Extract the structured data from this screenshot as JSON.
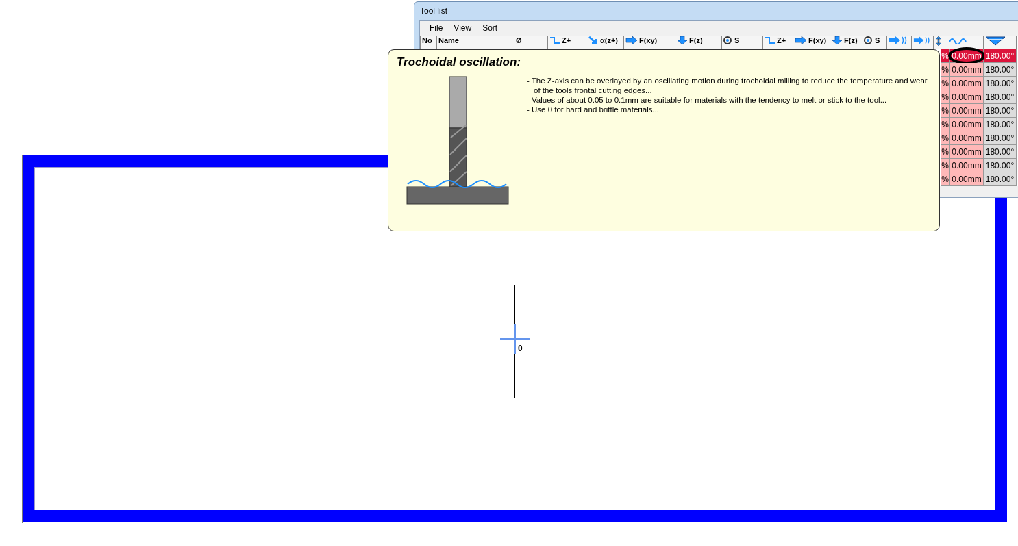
{
  "canvas": {
    "origin_label": "0"
  },
  "tool_list": {
    "title": "Tool list",
    "menu": [
      "File",
      "View",
      "Sort"
    ],
    "columns": [
      {
        "kind": "plain",
        "label": "No"
      },
      {
        "kind": "plain",
        "label": "Name"
      },
      {
        "kind": "plain",
        "label": "Ø"
      },
      {
        "kind": "step",
        "label": "Z+"
      },
      {
        "kind": "angle",
        "label": "α(z+)"
      },
      {
        "kind": "arrow",
        "label": "F(xy)"
      },
      {
        "kind": "down",
        "label": "F(z)"
      },
      {
        "kind": "spindle",
        "label": "S"
      },
      {
        "kind": "step",
        "label": "Z+"
      },
      {
        "kind": "arrow",
        "label": "F(xy)"
      },
      {
        "kind": "down",
        "label": "F(z)"
      },
      {
        "kind": "spindle",
        "label": "S"
      },
      {
        "kind": "arrowwave"
      },
      {
        "kind": "arrowwave"
      },
      {
        "kind": "updown"
      },
      {
        "kind": "wave"
      },
      {
        "kind": "cone"
      }
    ],
    "rows": [
      {
        "selected": true,
        "cells": [
          "%",
          "0.00mm",
          "180.00°"
        ]
      },
      {
        "selected": false,
        "cells": [
          "%",
          "0.00mm",
          "180.00°"
        ]
      },
      {
        "selected": false,
        "cells": [
          "%",
          "0.00mm",
          "180.00°"
        ]
      },
      {
        "selected": false,
        "cells": [
          "%",
          "0.00mm",
          "180.00°"
        ]
      },
      {
        "selected": false,
        "cells": [
          "%",
          "0.00mm",
          "180.00°"
        ]
      },
      {
        "selected": false,
        "cells": [
          "%",
          "0.00mm",
          "180.00°"
        ]
      },
      {
        "selected": false,
        "cells": [
          "%",
          "0.00mm",
          "180.00°"
        ]
      },
      {
        "selected": false,
        "cells": [
          "%",
          "0.00mm",
          "180.00°"
        ]
      },
      {
        "selected": false,
        "cells": [
          "%",
          "0.00mm",
          "180.00°"
        ]
      },
      {
        "selected": false,
        "cells": [
          "%",
          "0.00mm",
          "180.00°"
        ]
      }
    ]
  },
  "tooltip": {
    "title": "Trochoidal  oscillation:",
    "lines": [
      "- The Z-axis can be overlayed by an oscillating motion during trochoidal milling to reduce the temperature and wear of the tools frontal cutting edges...",
      "- Values of about 0.05 to 0.1mm are suitable for materials with the tendency to melt or stick to the tool...",
      "- Use 0 for hard and brittle materials..."
    ]
  }
}
